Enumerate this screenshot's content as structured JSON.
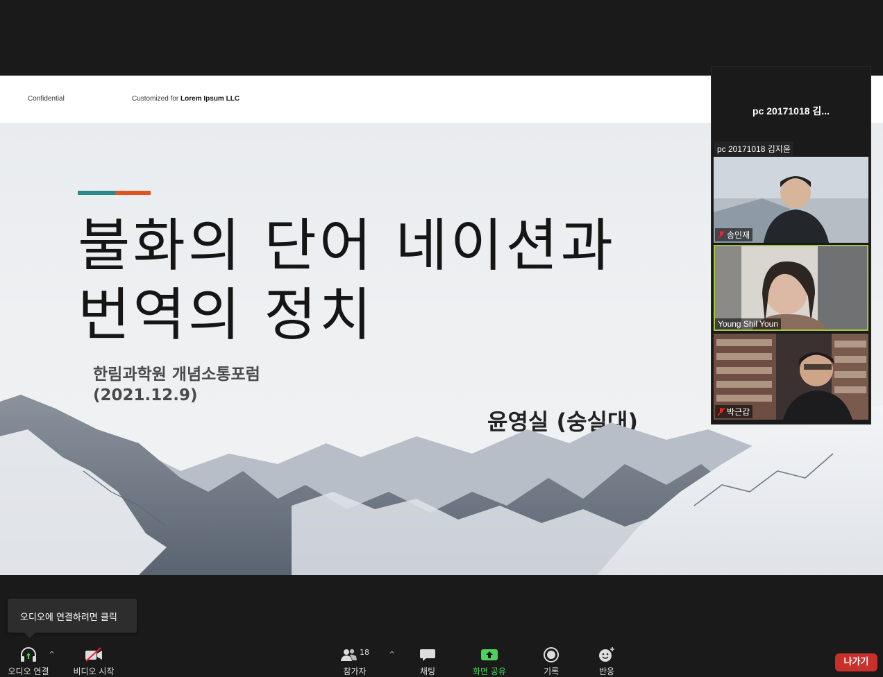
{
  "slide": {
    "confidential": "Confidential",
    "customized_prefix": "Customized for ",
    "customized_company": "Lorem Ipsum LLC",
    "title_line1": "불화의 단어 네이션과",
    "title_line2": "번역의 정치",
    "subtitle_line1": "한림과학원 개념소통포럼",
    "subtitle_line2": "(2021.12.9)",
    "author": "윤영실 (숭실대)",
    "accent_colors": [
      "#2a8a86",
      "#e0541f"
    ]
  },
  "gallery": {
    "pinned_name": "pc 20171018 김...",
    "small_name": "pc 20171018 김지윤",
    "participants": [
      {
        "name": "송인재",
        "muted": true
      },
      {
        "name": "Young Shil Youn",
        "muted": false,
        "active": true
      },
      {
        "name": "박근갑",
        "muted": true
      }
    ]
  },
  "tooltip": {
    "text": "오디오에 연결하려면 클릭"
  },
  "toolbar": {
    "audio": "오디오 연결",
    "video": "비디오 시작",
    "participants": "참가자",
    "participants_count": "18",
    "chat": "채팅",
    "share": "화면 공유",
    "record": "기록",
    "reactions": "반응",
    "leave": "나가기",
    "share_color": "#4bd35a"
  }
}
